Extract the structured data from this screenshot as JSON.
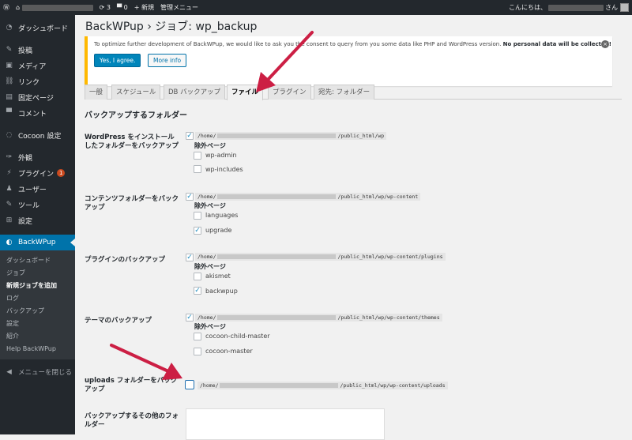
{
  "adminbar": {
    "wp_logo": "wordpress-icon",
    "update_count": "3",
    "comment_count": "0",
    "new_label": "+ 新規",
    "admin_menu_label": "管理メニュー",
    "greeting": "こんにちは、",
    "greeting_suffix": "さん"
  },
  "sidebar": {
    "items": [
      {
        "icon": "◔",
        "label": "ダッシュボード"
      },
      {
        "icon": "✎",
        "label": "投稿"
      },
      {
        "icon": "▣",
        "label": "メディア"
      },
      {
        "icon": "⛓",
        "label": "リンク"
      },
      {
        "icon": "▤",
        "label": "固定ページ"
      },
      {
        "icon": "▀",
        "label": "コメント"
      },
      {
        "icon": "◌",
        "label": "Cocoon 設定"
      },
      {
        "icon": "✑",
        "label": "外観"
      },
      {
        "icon": "⚡",
        "label": "プラグイン",
        "badge": "1"
      },
      {
        "icon": "♟",
        "label": "ユーザー"
      },
      {
        "icon": "✎",
        "label": "ツール"
      },
      {
        "icon": "⊞",
        "label": "設定"
      },
      {
        "icon": "◐",
        "label": "BackWPup"
      }
    ],
    "submenu": [
      "ダッシュボード",
      "ジョブ",
      "新規ジョブを追加",
      "ログ",
      "バックアップ",
      "設定",
      "紹介",
      "Help BackWPup"
    ],
    "collapse": "メニューを閉じる"
  },
  "page": {
    "title": "BackWPup › ジョブ: wp_backup"
  },
  "notice": {
    "message": "To optimize further development of BackWPup, we would like to ask you the consent to query from you some data like PHP and WordPress version.",
    "message_bold": "No personal data will be collected!",
    "yes_button": "Yes, I agree.",
    "more_button": "More info"
  },
  "tabs": [
    "一般",
    "スケジュール",
    "DB バックアップ",
    "ファイル",
    "プラグイン",
    "宛先: フォルダー"
  ],
  "section_title": "バックアップするフォルダー",
  "folders": {
    "wp": {
      "label": "WordPress をインストールしたフォルダーをバックアップ",
      "path_prefix": "/home/",
      "path_suffix": "/public_html/wp",
      "exclude_label": "除外ページ",
      "options": [
        {
          "label": "wp-admin",
          "checked": false
        },
        {
          "label": "wp-includes",
          "checked": false
        }
      ]
    },
    "content": {
      "label": "コンテンツフォルダーをバックアップ",
      "path_prefix": "/home/",
      "path_suffix": "/public_html/wp/wp-content",
      "exclude_label": "除外ページ",
      "options": [
        {
          "label": "languages",
          "checked": false
        },
        {
          "label": "upgrade",
          "checked": true
        }
      ]
    },
    "plugins": {
      "label": "プラグインのバックアップ",
      "path_prefix": "/home/",
      "path_suffix": "/public_html/wp/wp-content/plugins",
      "exclude_label": "除外ページ",
      "options": [
        {
          "label": "akismet",
          "checked": false
        },
        {
          "label": "backwpup",
          "checked": true
        }
      ]
    },
    "themes": {
      "label": "テーマのバックアップ",
      "path_prefix": "/home/",
      "path_suffix": "/public_html/wp/wp-content/themes",
      "exclude_label": "除外ページ",
      "options": [
        {
          "label": "cocoon-child-master",
          "checked": false
        },
        {
          "label": "cocoon-master",
          "checked": false
        }
      ]
    },
    "uploads": {
      "label": "uploads フォルダーをバックアップ",
      "path_prefix": "/home/",
      "path_suffix": "/public_html/wp/wp-content/uploads",
      "checked": false
    },
    "other": {
      "label": "バックアップするその他のフォルダー"
    }
  },
  "annotation_color": "#cc1f44"
}
